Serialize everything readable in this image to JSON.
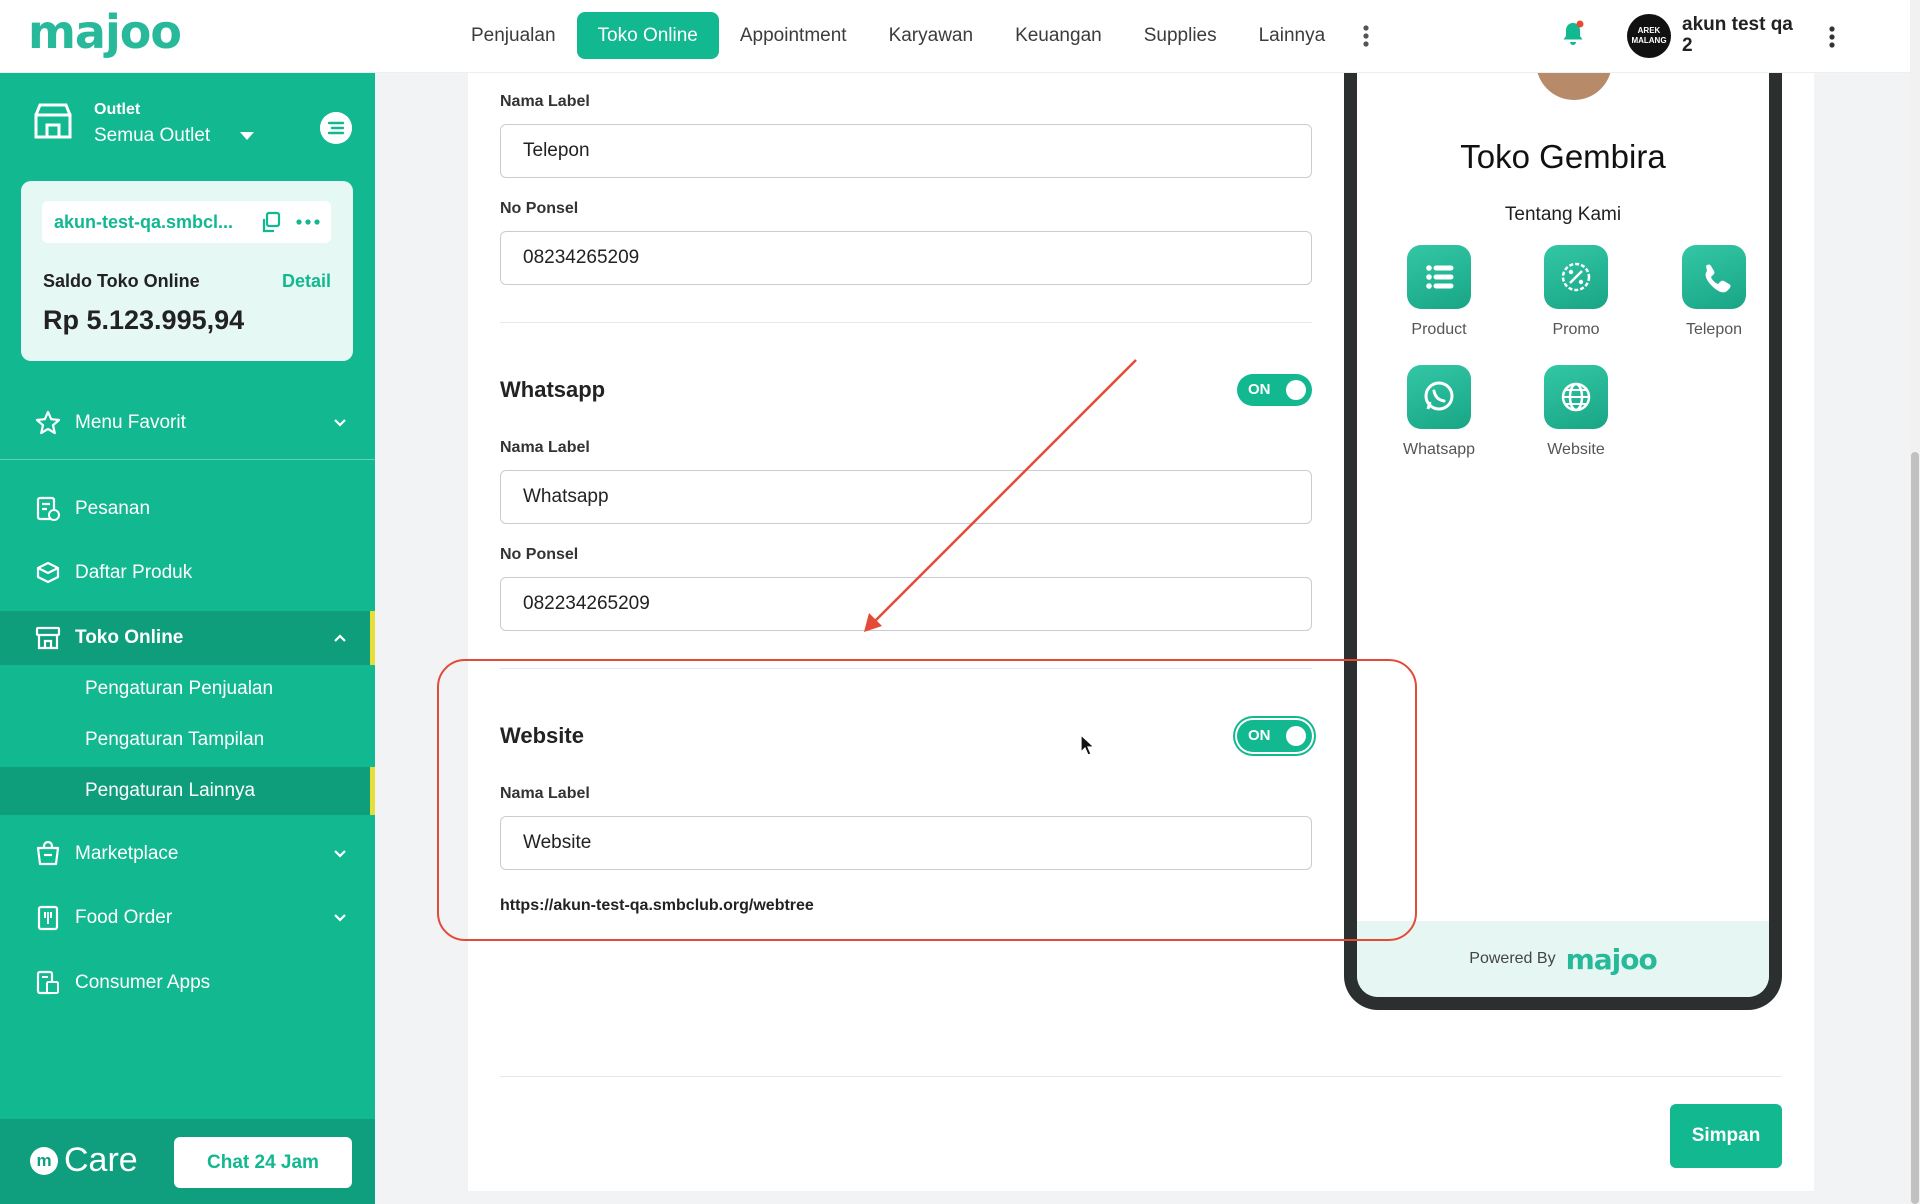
{
  "header": {
    "logo": "majoo",
    "nav": [
      {
        "label": "Penjualan",
        "active": false
      },
      {
        "label": "Toko Online",
        "active": true
      },
      {
        "label": "Appointment",
        "active": false
      },
      {
        "label": "Karyawan",
        "active": false
      },
      {
        "label": "Keuangan",
        "active": false
      },
      {
        "label": "Supplies",
        "active": false
      },
      {
        "label": "Lainnya",
        "active": false
      }
    ],
    "avatar_text": "AREK MALANG",
    "user_name": "akun test qa 2"
  },
  "sidebar": {
    "outlet_label": "Outlet",
    "outlet_value": "Semua Outlet",
    "domain": "akun-test-qa.smbcl...",
    "saldo_label": "Saldo Toko Online",
    "saldo_detail": "Detail",
    "saldo_value": "Rp 5.123.995,94",
    "menu": {
      "favorit": "Menu Favorit",
      "pesanan": "Pesanan",
      "daftar_produk": "Daftar Produk",
      "toko_online": "Toko Online",
      "marketplace": "Marketplace",
      "food_order": "Food Order",
      "consumer_apps": "Consumer Apps"
    },
    "submenu": [
      {
        "label": "Pengaturan Penjualan",
        "active": false
      },
      {
        "label": "Pengaturan Tampilan",
        "active": false
      },
      {
        "label": "Pengaturan Lainnya",
        "active": true
      }
    ],
    "care_label": "Care",
    "care_m": "m",
    "chat_button": "Chat 24 Jam"
  },
  "form": {
    "telepon": {
      "label_caption": "Nama Label",
      "label_value": "Telepon",
      "phone_caption": "No Ponsel",
      "phone_value": "08234265209"
    },
    "whatsapp": {
      "title": "Whatsapp",
      "toggle": "ON",
      "label_caption": "Nama Label",
      "label_value": "Whatsapp",
      "phone_caption": "No Ponsel",
      "phone_value": "082234265209"
    },
    "website": {
      "title": "Website",
      "toggle": "ON",
      "label_caption": "Nama Label",
      "label_value": "Website",
      "url": "https://akun-test-qa.smbclub.org/webtree"
    },
    "save_button": "Simpan"
  },
  "preview": {
    "store_name": "Toko Gembira",
    "subtitle": "Tentang Kami",
    "apps": [
      {
        "label": "Product",
        "icon": "list-icon"
      },
      {
        "label": "Promo",
        "icon": "promo-icon"
      },
      {
        "label": "Telepon",
        "icon": "phone-icon"
      },
      {
        "label": "Whatsapp",
        "icon": "whatsapp-icon"
      },
      {
        "label": "Website",
        "icon": "globe-icon"
      }
    ],
    "powered_by": "Powered By",
    "powered_logo": "majoo"
  },
  "colors": {
    "brand": "#12b890",
    "annotation": "#e34b36",
    "sidebar_accent": "#e6df3a"
  }
}
